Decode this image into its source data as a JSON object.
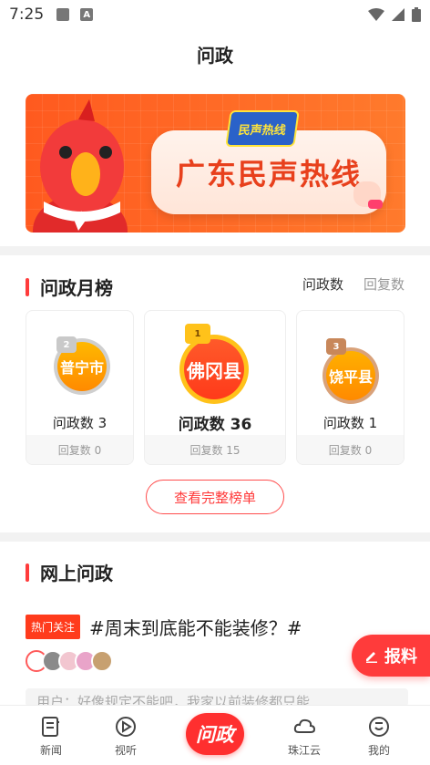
{
  "status_bar": {
    "time": "7:25"
  },
  "header": {
    "title": "问政"
  },
  "banner": {
    "headline": "广东民声热线",
    "logo_text": "民声热线"
  },
  "monthly_ranking": {
    "title": "问政月榜",
    "tabs": [
      {
        "label": "问政数",
        "active": true
      },
      {
        "label": "回复数",
        "active": false
      }
    ],
    "entries": [
      {
        "rank": "2",
        "name": "普宁市",
        "ask_label": "问政数 3",
        "reply_label": "回复数 0"
      },
      {
        "rank": "1",
        "name": "佛冈县",
        "ask_label": "问政数 36",
        "reply_label": "回复数 15"
      },
      {
        "rank": "3",
        "name": "饶平县",
        "ask_label": "问政数 1",
        "reply_label": "回复数 0"
      }
    ],
    "full_list_button": "查看完整榜单"
  },
  "online": {
    "title": "网上问政",
    "hot_tag": "热门关注",
    "hot_topic": "#周末到底能不能装修？#",
    "comment_preview": "用户：好像规定不能吧，我家以前装修都只能"
  },
  "report_button": "报料",
  "bottom_nav": [
    {
      "label": "新闻",
      "icon": "news-icon"
    },
    {
      "label": "视听",
      "icon": "play-icon"
    },
    {
      "label": "问政",
      "icon": "wenzheng-icon"
    },
    {
      "label": "珠江云",
      "icon": "cloud-icon"
    },
    {
      "label": "我的",
      "icon": "profile-icon"
    }
  ],
  "colors": {
    "accent": "#ff3b3b",
    "banner": "#ff6a26",
    "gold": "#ffb300",
    "silver": "#c9c9c9",
    "bronze": "#c8875a"
  }
}
